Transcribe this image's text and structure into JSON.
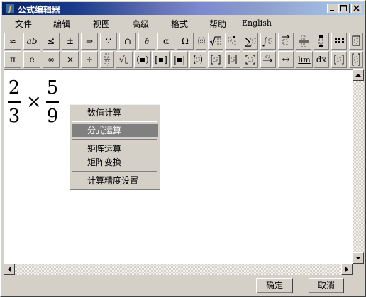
{
  "window": {
    "title": "公式编辑器"
  },
  "menu": [
    "文件",
    "编辑",
    "视图",
    "高级",
    "格式",
    "帮助",
    "English"
  ],
  "toolbar1": [
    {
      "name": "approx-symbol",
      "glyph": "≈"
    },
    {
      "name": "ab-spacing",
      "glyph": "ab"
    },
    {
      "name": "not-less-equal",
      "glyph": "≰"
    },
    {
      "name": "plus-minus",
      "glyph": "±"
    },
    {
      "name": "right-arrow",
      "glyph": "⇒"
    },
    {
      "name": "logic-dots",
      "glyph": "∵"
    },
    {
      "name": "set-intersection",
      "glyph": "∩"
    },
    {
      "name": "partial-derivative",
      "glyph": "∂"
    },
    {
      "name": "greek-lower",
      "glyph": "α"
    },
    {
      "name": "greek-upper",
      "glyph": "Ω"
    }
  ],
  "toolbar2": [
    {
      "name": "pi",
      "glyph": "π"
    },
    {
      "name": "e",
      "glyph": "e"
    },
    {
      "name": "infinity",
      "glyph": "∞"
    },
    {
      "name": "times",
      "glyph": "×"
    },
    {
      "name": "divide",
      "glyph": "÷"
    }
  ],
  "toolbar2b": [
    {
      "name": "sqrt",
      "glyph": "√▯"
    },
    {
      "name": "parens",
      "glyph": "(▪)"
    },
    {
      "name": "brackets",
      "glyph": "[▪]"
    },
    {
      "name": "abs",
      "glyph": "|▪|"
    }
  ],
  "toolbar2c": [
    {
      "name": "limit",
      "glyph": "lim"
    },
    {
      "name": "differential",
      "glyph": "dx"
    }
  ],
  "formula": {
    "n1": "2",
    "d1": "3",
    "op": "×",
    "n2": "5",
    "d2": "9"
  },
  "context_menu": {
    "items": [
      "数值计算",
      "分式运算",
      "矩阵运算",
      "矩阵变换",
      "计算精度设置"
    ],
    "selected": "分式运算"
  },
  "buttons": {
    "ok": "确定",
    "cancel": "取消"
  },
  "colors": {
    "title_start": "#0a246a",
    "title_end": "#a6caf0",
    "highlight": "#808080"
  }
}
